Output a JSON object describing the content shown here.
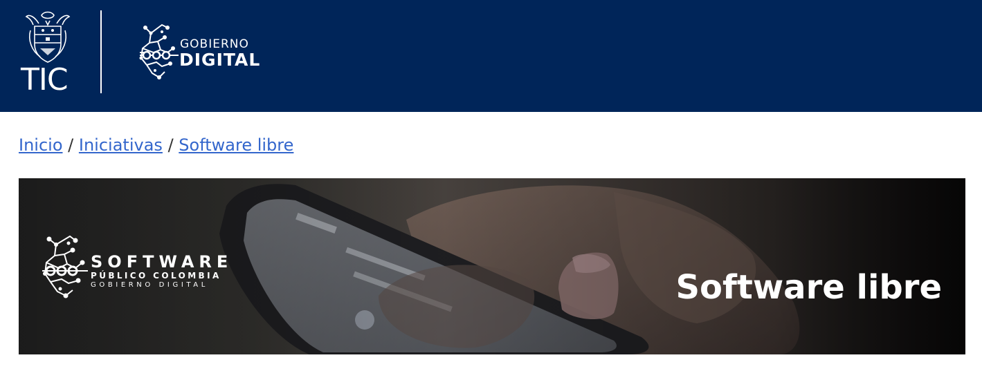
{
  "header": {
    "tic_label": "TIC",
    "gobierno_digital": {
      "line1": "GOBIERNO",
      "line2": "DIGITAL"
    },
    "background_color": "#002559"
  },
  "breadcrumb": {
    "items": [
      "Inicio",
      "Iniciativas",
      "Software libre"
    ],
    "separator": "/",
    "link_color": "#3366cc"
  },
  "hero": {
    "title": "Software libre",
    "logo": {
      "line1": "SOFTWARE",
      "line2": "PÚBLICO COLOMBIA",
      "line3": "GOBIERNO DIGITAL"
    }
  }
}
